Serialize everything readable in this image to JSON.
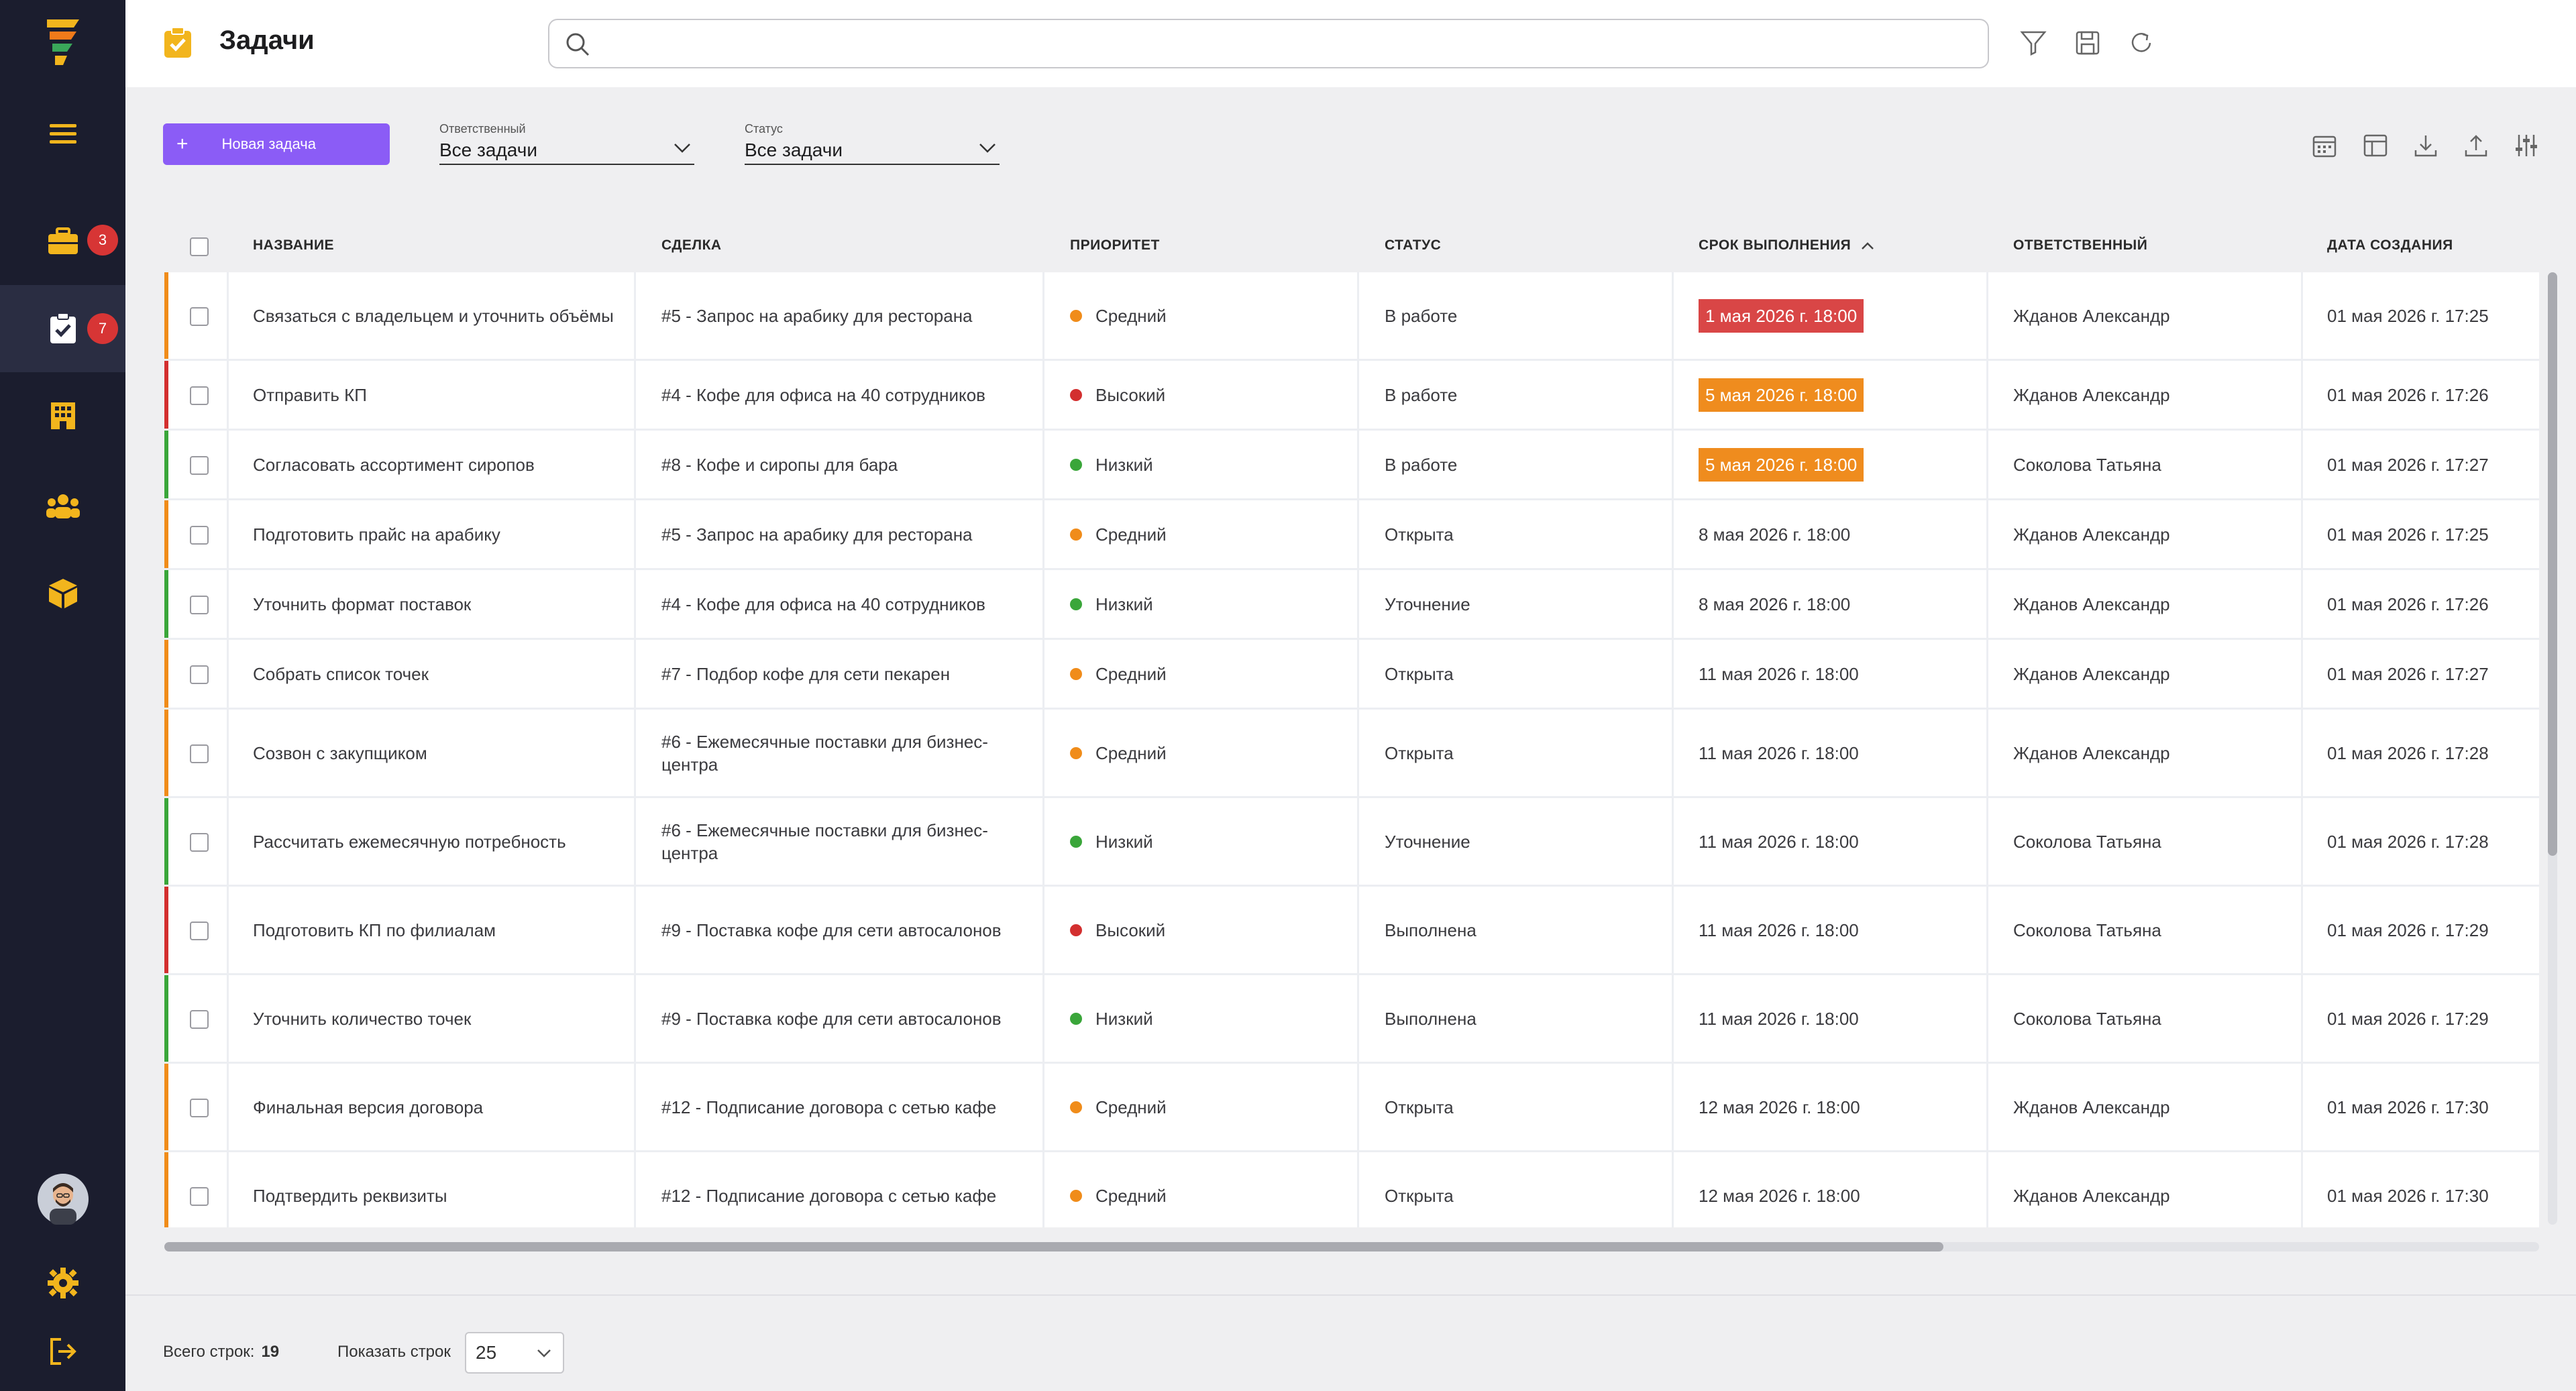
{
  "sidebar": {
    "items": [
      {
        "name": "menu",
        "icon": "hamburger-icon"
      },
      {
        "name": "deals",
        "icon": "briefcase-icon",
        "badge": "3"
      },
      {
        "name": "tasks",
        "icon": "clipboard-check-icon",
        "badge": "7",
        "active": true
      },
      {
        "name": "companies",
        "icon": "building-icon"
      },
      {
        "name": "contacts",
        "icon": "people-icon"
      },
      {
        "name": "products",
        "icon": "box-icon"
      }
    ]
  },
  "header": {
    "title": "Задачи",
    "search_value": ""
  },
  "toolbar": {
    "new_task_label": "Новая задача",
    "assignee_filter": {
      "label": "Ответственный",
      "value": "Все задачи"
    },
    "status_filter": {
      "label": "Статус",
      "value": "Все задачи"
    }
  },
  "table": {
    "columns": [
      "НАЗВАНИЕ",
      "СДЕЛКА",
      "ПРИОРИТЕТ",
      "СТАТУС",
      "СРОК ВЫПОЛНЕНИЯ",
      "ОТВЕТСТВЕННЫЙ",
      "ДАТА СОЗДАНИЯ"
    ],
    "rows": [
      {
        "title": "Связаться с владельцем и уточнить объёмы",
        "deal": "#5 - Запрос на арабику для ресторана",
        "priority": "Средний",
        "status": "В работе",
        "deadline": "1 мая 2026 г. 18:00",
        "deadline_state": "overdue",
        "assignee": "Жданов Александр",
        "created": "01 мая 2026 г. 17:25",
        "unread": true
      },
      {
        "title": "Отправить КП",
        "deal": "#4 - Кофе для офиса на 40 сотрудников",
        "priority": "Высокий",
        "status": "В работе",
        "deadline": "5 мая 2026 г. 18:00",
        "deadline_state": "soon",
        "assignee": "Жданов Александр",
        "created": "01 мая 2026 г. 17:26",
        "unread": false
      },
      {
        "title": "Согласовать ассортимент сиропов",
        "deal": "#8 - Кофе и сиропы для бара",
        "priority": "Низкий",
        "status": "В работе",
        "deadline": "5 мая 2026 г. 18:00",
        "deadline_state": "soon",
        "assignee": "Соколова Татьяна",
        "created": "01 мая 2026 г. 17:27",
        "unread": false
      },
      {
        "title": "Подготовить прайс на арабику",
        "deal": "#5 - Запрос на арабику для ресторана",
        "priority": "Средний",
        "status": "Открыта",
        "deadline": "8 мая 2026 г. 18:00",
        "deadline_state": "normal",
        "assignee": "Жданов Александр",
        "created": "01 мая 2026 г. 17:25",
        "unread": false
      },
      {
        "title": "Уточнить формат поставок",
        "deal": "#4 - Кофе для офиса на 40 сотрудников",
        "priority": "Низкий",
        "status": "Уточнение",
        "deadline": "8 мая 2026 г. 18:00",
        "deadline_state": "normal",
        "assignee": "Жданов Александр",
        "created": "01 мая 2026 г. 17:26",
        "unread": false
      },
      {
        "title": "Собрать список точек",
        "deal": "#7 - Подбор кофе для сети пекарен",
        "priority": "Средний",
        "status": "Открыта",
        "deadline": "11 мая 2026 г. 18:00",
        "deadline_state": "normal",
        "assignee": "Жданов Александр",
        "created": "01 мая 2026 г. 17:27",
        "unread": true
      },
      {
        "title": "Созвон с закупщиком",
        "deal": "#6 - Ежемесячные поставки для бизнес-центра",
        "priority": "Средний",
        "status": "Открыта",
        "deadline": "11 мая 2026 г. 18:00",
        "deadline_state": "normal",
        "assignee": "Жданов Александр",
        "created": "01 мая 2026 г. 17:28",
        "unread": false
      },
      {
        "title": "Рассчитать ежемесячную потребность",
        "deal": "#6 - Ежемесячные поставки для бизнес-центра",
        "priority": "Низкий",
        "status": "Уточнение",
        "deadline": "11 мая 2026 г. 18:00",
        "deadline_state": "normal",
        "assignee": "Соколова Татьяна",
        "created": "01 мая 2026 г. 17:28",
        "unread": false
      },
      {
        "title": "Подготовить КП по филиалам",
        "deal": "#9 - Поставка кофе для сети автосалонов",
        "priority": "Высокий",
        "status": "Выполнена",
        "deadline": "11 мая 2026 г. 18:00",
        "deadline_state": "normal",
        "assignee": "Соколова Татьяна",
        "created": "01 мая 2026 г. 17:29",
        "unread": false
      },
      {
        "title": "Уточнить количество точек",
        "deal": "#9 - Поставка кофе для сети автосалонов",
        "priority": "Низкий",
        "status": "Выполнена",
        "deadline": "11 мая 2026 г. 18:00",
        "deadline_state": "normal",
        "assignee": "Соколова Татьяна",
        "created": "01 мая 2026 г. 17:29",
        "unread": false
      },
      {
        "title": "Финальная версия договора",
        "deal": "#12 - Подписание договора с сетью кафе",
        "priority": "Средний",
        "status": "Открыта",
        "deadline": "12 мая 2026 г. 18:00",
        "deadline_state": "normal",
        "assignee": "Жданов Александр",
        "created": "01 мая 2026 г. 17:30",
        "unread": true
      },
      {
        "title": "Подтвердить реквизиты",
        "deal": "#12 - Подписание договора с сетью кафе",
        "priority": "Средний",
        "status": "Открыта",
        "deadline": "12 мая 2026 г. 18:00",
        "deadline_state": "normal",
        "assignee": "Жданов Александр",
        "created": "01 мая 2026 г. 17:30",
        "unread": true
      }
    ]
  },
  "footer": {
    "total_label": "Всего строк:",
    "total_value": "19",
    "page_size_label": "Показать строк",
    "page_size_value": "25"
  },
  "colors": {
    "accent": "#8b5cf6",
    "priority_high": "#d32f2f",
    "priority_medium": "#f08c1a",
    "priority_low": "#3aa63a",
    "deadline_overdue": "#d94646",
    "deadline_soon": "#ef8c1e",
    "unread_dot": "#2f8fe8"
  }
}
